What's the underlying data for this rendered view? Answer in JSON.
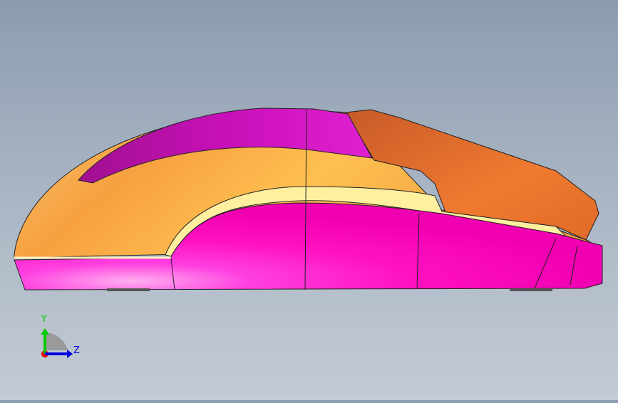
{
  "viewport": {
    "model": "computer-mouse",
    "colors": {
      "magenta": "#ff10c8",
      "magenta_dark": "#c000a0",
      "orange_light": "#ffc860",
      "orange": "#f59a3a",
      "orange_dark": "#d85a20",
      "beige": "#fff0a0"
    }
  },
  "triad": {
    "y_label": "Y",
    "z_label": "Z",
    "y_color": "#00cc00",
    "z_color": "#0000dd",
    "x_color": "#ee0000"
  }
}
